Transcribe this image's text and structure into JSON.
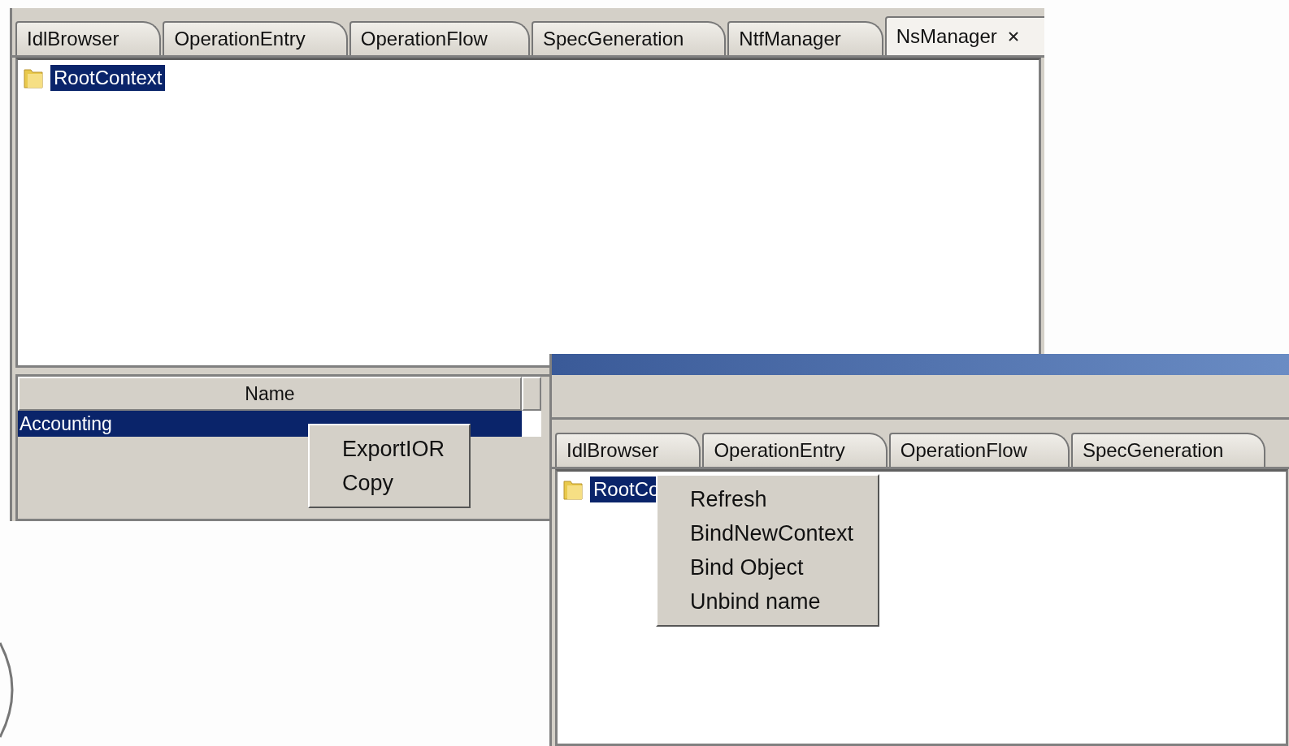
{
  "windows": [
    {
      "tabs": [
        {
          "label": "IdlBrowser",
          "selected": false,
          "closable": false
        },
        {
          "label": "OperationEntry",
          "selected": false,
          "closable": false
        },
        {
          "label": "OperationFlow",
          "selected": false,
          "closable": false
        },
        {
          "label": "SpecGeneration",
          "selected": false,
          "closable": false
        },
        {
          "label": "NtfManager",
          "selected": false,
          "closable": false
        },
        {
          "label": "NsManager",
          "selected": true,
          "closable": true
        }
      ],
      "tree": {
        "items": [
          {
            "label": "RootContext",
            "selected": true
          }
        ]
      },
      "table": {
        "columns": [
          "Name"
        ],
        "rows": [
          {
            "cells": [
              "Accounting"
            ],
            "selected": true
          }
        ]
      },
      "context_menu": {
        "items": [
          "ExportIOR",
          "Copy"
        ]
      }
    },
    {
      "tabs": [
        {
          "label": "IdlBrowser",
          "selected": false,
          "closable": false
        },
        {
          "label": "OperationEntry",
          "selected": false,
          "closable": false
        },
        {
          "label": "OperationFlow",
          "selected": false,
          "closable": false
        },
        {
          "label": "SpecGeneration",
          "selected": false,
          "closable": false
        }
      ],
      "tree": {
        "items": [
          {
            "label": "RootCo",
            "selected": true
          }
        ]
      },
      "context_menu": {
        "items": [
          "Refresh",
          "BindNewContext",
          "Bind Object",
          "Unbind name"
        ]
      }
    }
  ]
}
